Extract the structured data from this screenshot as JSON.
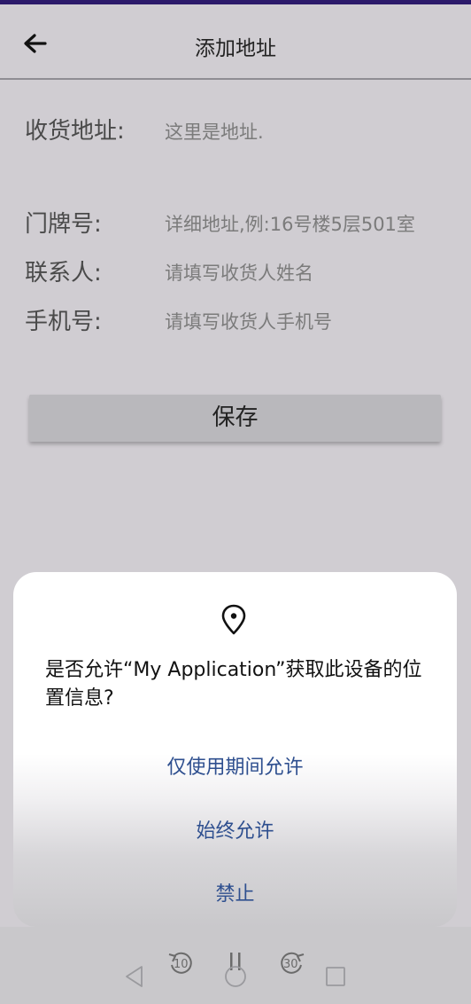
{
  "header": {
    "title": "添加地址"
  },
  "form": {
    "address_label": "收货地址:",
    "address_value": "这里是地址.",
    "door_label": "门牌号:",
    "door_placeholder": "详细地址,例:16号楼5层501室",
    "contact_label": "联系人:",
    "contact_placeholder": "请填写收货人姓名",
    "phone_label": "手机号:",
    "phone_placeholder": "请填写收货人手机号"
  },
  "save_label": "保存",
  "dialog": {
    "message": "是否允许“My Application”获取此设备的位置信息?",
    "option_while_using": "仅使用期间允许",
    "option_always": "始终允许",
    "option_deny": "禁止"
  },
  "media_controls": {
    "rewind_label": "10",
    "forward_label": "30"
  },
  "icons": {
    "back": "back-arrow-icon",
    "location": "location-pin-icon",
    "rewind": "rewind-10-icon",
    "pause": "pause-icon",
    "forward": "forward-30-icon",
    "nav_back": "nav-back-icon",
    "nav_home": "nav-home-icon",
    "nav_recent": "nav-recent-icon"
  },
  "colors": {
    "status_bar": "#2c1a6b",
    "dialog_option": "#2e4f8f",
    "background": "#d0cdd2"
  }
}
